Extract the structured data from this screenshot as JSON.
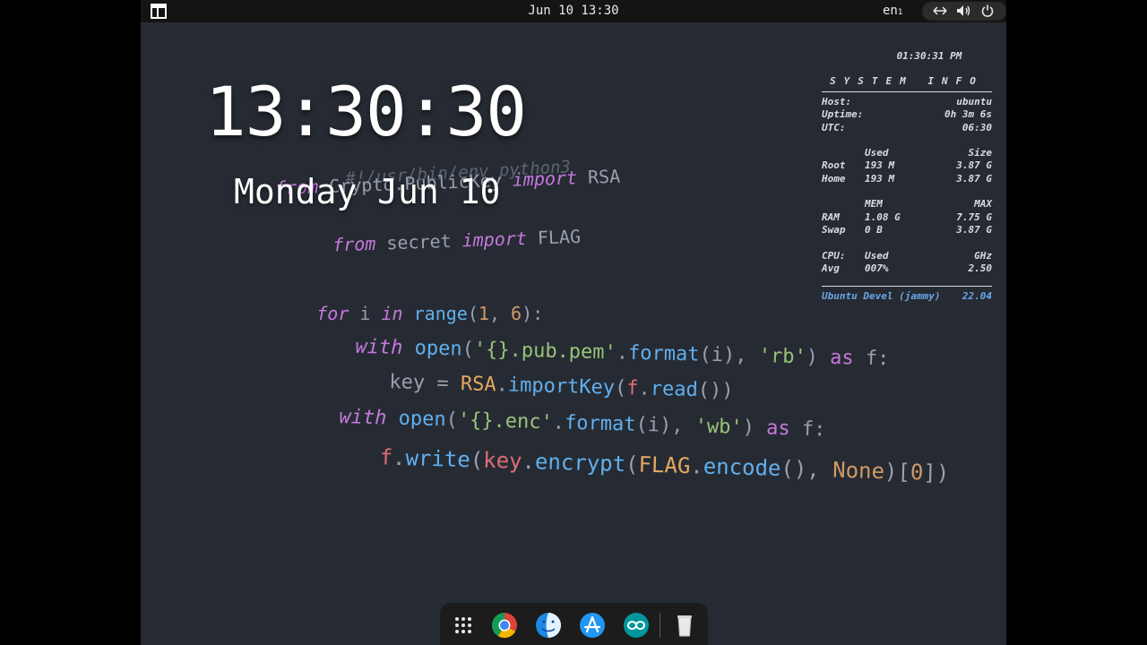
{
  "topbar": {
    "clock": "Jun 10 13:30",
    "lang": "en",
    "lang_sub": "1"
  },
  "desktop": {
    "big_clock": "13:30:30",
    "date": "Monday Jun 10"
  },
  "code_lines": [
    {
      "text": "#!/usr/bin/env python3"
    },
    {
      "text": "from Crypto.PublicKey import RSA"
    },
    {
      "text": "from secret import FLAG"
    },
    {
      "text": "for i in range(1, 6):"
    },
    {
      "text": "with open('{}.pub.pem'.format(i), 'rb') as f:"
    },
    {
      "text": "key = RSA.importKey(f.read())"
    },
    {
      "text": "with open('{}.enc'.format(i), 'wb') as f:"
    },
    {
      "text": "f.write(key.encrypt(FLAG.encode(), None)[0])"
    }
  ],
  "sysinfo": {
    "time": "01:30:31 PM",
    "title": "SYSTEM INFO",
    "host_label": "Host:",
    "host": "ubuntu",
    "uptime_label": "Uptime:",
    "uptime": "0h 3m 6s",
    "utc_label": "UTC:",
    "utc": "06:30",
    "disk_used_h": "Used",
    "disk_size_h": "Size",
    "root_label": "Root",
    "root_used": "193 M",
    "root_size": "3.87 G",
    "home_label": "Home",
    "home_used": "193 M",
    "home_size": "3.87 G",
    "mem_h": "MEM",
    "max_h": "MAX",
    "ram_label": "RAM",
    "ram_used": "1.08 G",
    "ram_max": "7.75 G",
    "swap_label": "Swap",
    "swap_used": "0 B",
    "swap_max": "3.87 G",
    "cpu_label": "CPU:",
    "cpu_used_h": "Used",
    "cpu_ghz_h": "GHz",
    "avg_label": "Avg",
    "avg_used": "007%",
    "avg_ghz": "2.50",
    "distro": "Ubuntu Devel (jammy)",
    "version": "22.04"
  },
  "dock": {
    "items": [
      "apps-grid-icon",
      "chrome-icon",
      "finder-icon",
      "app-store-icon",
      "arduino-icon",
      "trash-icon"
    ]
  },
  "colors": {
    "screen_bg": "#262b33",
    "topbar_bg": "#141414",
    "keyword": "#c678dd",
    "function": "#61afef",
    "string": "#98c379",
    "number": "#d19a66",
    "sysinfo_accent": "#6aa6e8"
  }
}
